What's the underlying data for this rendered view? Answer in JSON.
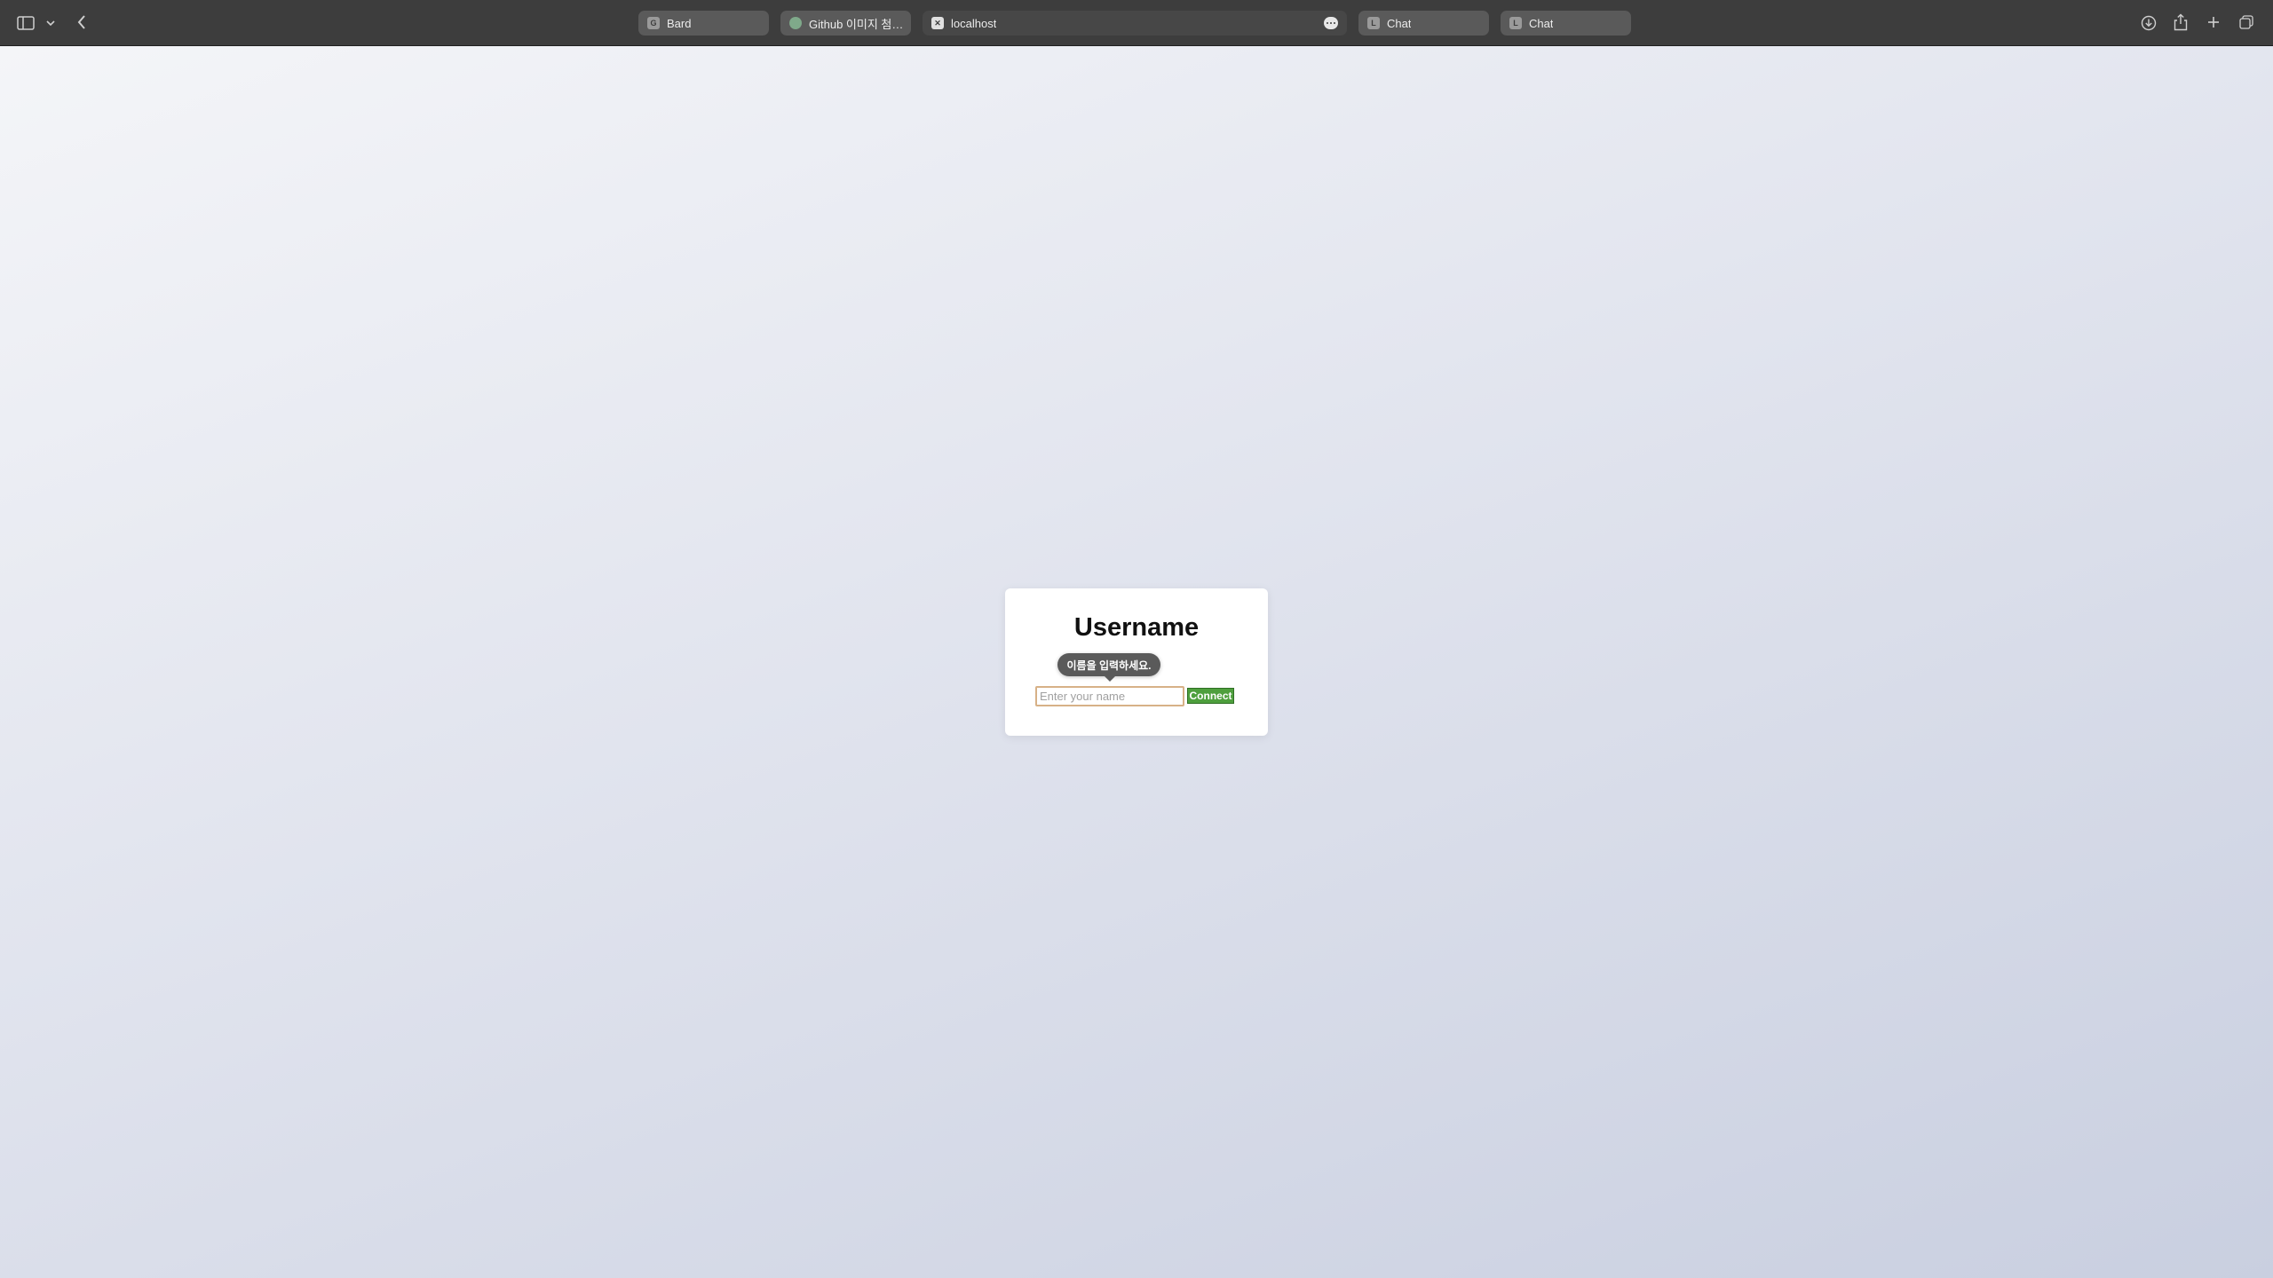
{
  "browser": {
    "tabs": [
      {
        "label": "Bard",
        "favicon": "G",
        "active": false
      },
      {
        "label": "Github 이미지 첨부...",
        "favicon": "",
        "active": false
      },
      {
        "label": "localhost",
        "favicon": "✕",
        "active": true
      },
      {
        "label": "Chat",
        "favicon": "L",
        "active": false
      },
      {
        "label": "Chat",
        "favicon": "L",
        "active": false
      }
    ],
    "icons": {
      "sidebar": "sidebar-toggle-icon",
      "sidebar_menu": "chevron-down-icon",
      "back": "chevron-left-icon",
      "tab_more": "ellipsis-icon",
      "downloads": "download-icon",
      "share": "share-icon",
      "new_tab": "plus-icon",
      "tab_overview": "tab-overview-icon"
    }
  },
  "login": {
    "title": "Username",
    "input_placeholder": "Enter your name",
    "input_value": "",
    "connect_label": "Connect",
    "validation_tooltip": "이름을 입력하세요."
  },
  "colors": {
    "toolbar_bg": "#3d3d3d",
    "connect_bg": "#4e9f3d",
    "input_border": "#d7b187",
    "tooltip_bg": "#5a5a5a"
  }
}
